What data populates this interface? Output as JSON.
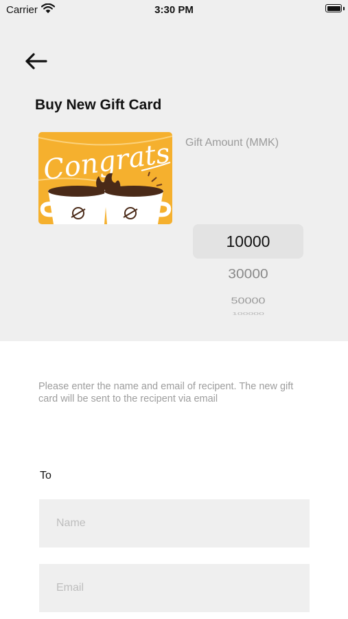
{
  "status_bar": {
    "carrier": "Carrier",
    "time": "3:30 PM"
  },
  "header": {
    "title": "Buy New Gift Card"
  },
  "gift_card": {
    "image_text": "Congrats"
  },
  "amount": {
    "label": "Gift Amount (MMK)",
    "options": [
      "10000",
      "30000",
      "50000",
      "100000"
    ],
    "selected": "10000"
  },
  "info_text": "Please enter the name and email of recipent. The new gift card will be sent to the recipent via email",
  "recipient": {
    "section_label": "To",
    "name_placeholder": "Name",
    "email_placeholder": "Email"
  },
  "colors": {
    "card_yellow": "#f5b02e",
    "background_gray": "#efefef"
  }
}
